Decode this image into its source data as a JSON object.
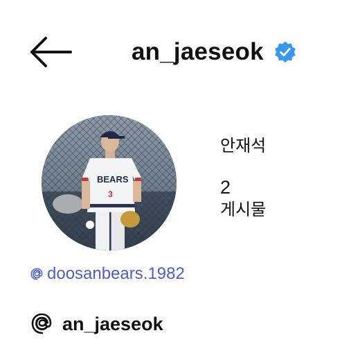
{
  "header": {
    "username": "an_jaeseok",
    "verified": true,
    "verified_color": "#3897f0",
    "back_icon": "arrow-left-icon"
  },
  "profile": {
    "full_name": "안재석",
    "posts_count": "2",
    "posts_label": "게시물",
    "avatar_icon": "profile-photo"
  },
  "links": {
    "threads_handle_text": "doosanbears.1982",
    "threads_handle_color": "#4a60c8"
  },
  "threads_badge": {
    "icon": "threads-logo-icon",
    "name": "an_jaeseok"
  }
}
